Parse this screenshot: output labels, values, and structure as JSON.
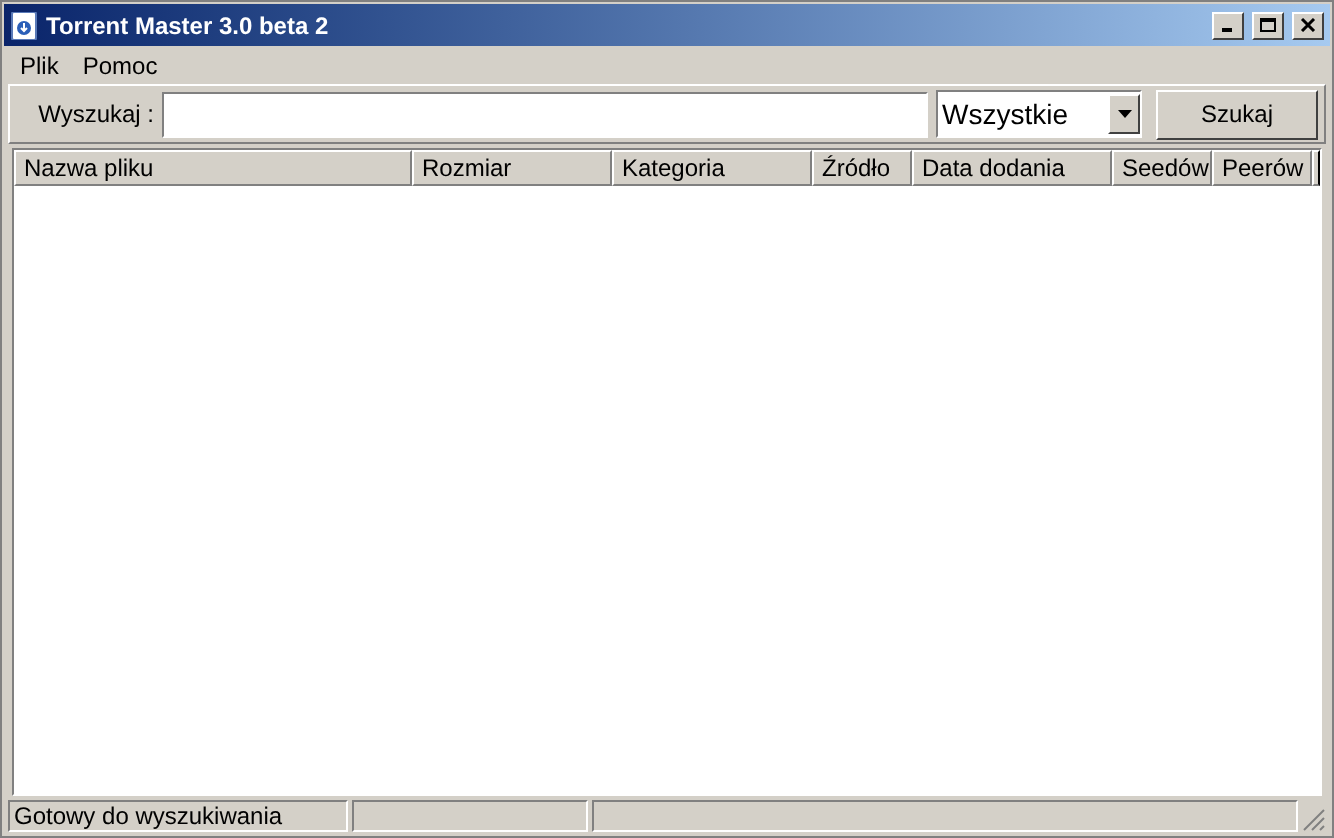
{
  "window": {
    "title": "Torrent Master 3.0 beta 2"
  },
  "menu": [
    "Plik",
    "Pomoc"
  ],
  "search": {
    "label": "Wyszukaj :",
    "category": "Wszystkie",
    "button": "Szukaj"
  },
  "table": {
    "columns": [
      {
        "label": "Nazwa pliku"
      },
      {
        "label": "Rozmiar"
      },
      {
        "label": "Kategoria"
      },
      {
        "label": "Źródło"
      },
      {
        "label": "Data dodania"
      },
      {
        "label": "Seedów"
      },
      {
        "label": "Peerów"
      }
    ]
  },
  "status_bar": {
    "message": "Gotowy do wyszukiwania"
  }
}
